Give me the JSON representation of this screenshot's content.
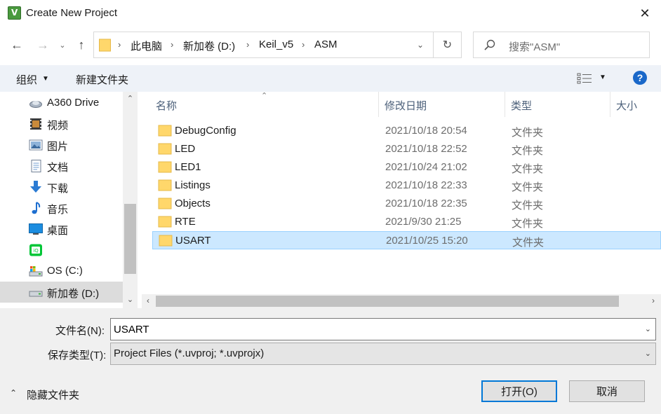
{
  "window": {
    "title": "Create New Project",
    "close_glyph": "✕",
    "app_icon": "keil-uvision-icon"
  },
  "nav": {
    "back_glyph": "←",
    "forward_glyph": "→",
    "recent_glyph": "⌄",
    "up_glyph": "↑"
  },
  "address": {
    "crumbs": [
      "此电脑",
      "新加卷 (D:)",
      "Keil_v5",
      "ASM"
    ],
    "separator": "›",
    "dropdown_glyph": "⌄",
    "refresh_glyph": "↻"
  },
  "search": {
    "placeholder": "搜索\"ASM\""
  },
  "toolbar": {
    "organize_label": "组织",
    "organize_caret": "▼",
    "new_folder_label": "新建文件夹",
    "view_caret": "▼",
    "help_label": "?"
  },
  "navpane": {
    "items": [
      {
        "label": "A360 Drive",
        "icon": "cloud-drive-icon"
      },
      {
        "label": "视频",
        "icon": "video-icon"
      },
      {
        "label": "图片",
        "icon": "pictures-icon"
      },
      {
        "label": "文档",
        "icon": "documents-icon"
      },
      {
        "label": "下载",
        "icon": "download-icon"
      },
      {
        "label": "音乐",
        "icon": "music-icon"
      },
      {
        "label": "桌面",
        "icon": "desktop-icon"
      },
      {
        "label": "",
        "icon": "iqiyi-icon"
      },
      {
        "label": "OS (C:)",
        "icon": "drive-c-icon"
      },
      {
        "label": "新加卷 (D:)",
        "icon": "drive-d-icon"
      }
    ],
    "selected_index": 9,
    "scroll_up_glyph": "⌃",
    "scroll_down_glyph": "⌄"
  },
  "filelist": {
    "columns": [
      "名称",
      "修改日期",
      "类型",
      "大小"
    ],
    "sort_glyph": "⌃",
    "rows": [
      {
        "name": "DebugConfig",
        "date": "2021/10/18 20:54",
        "type": "文件夹"
      },
      {
        "name": "LED",
        "date": "2021/10/18 22:52",
        "type": "文件夹"
      },
      {
        "name": "LED1",
        "date": "2021/10/24 21:02",
        "type": "文件夹"
      },
      {
        "name": "Listings",
        "date": "2021/10/18 22:33",
        "type": "文件夹"
      },
      {
        "name": "Objects",
        "date": "2021/10/18 22:35",
        "type": "文件夹"
      },
      {
        "name": "RTE",
        "date": "2021/9/30 21:25",
        "type": "文件夹"
      },
      {
        "name": "USART",
        "date": "2021/10/25 15:20",
        "type": "文件夹"
      }
    ],
    "selected_index": 6,
    "hscroll_left_glyph": "‹",
    "hscroll_right_glyph": "›"
  },
  "form": {
    "filename_label": "文件名(N):",
    "filename_value": "USART",
    "filetype_label": "保存类型(T):",
    "filetype_value": "Project Files (*.uvproj; *.uvprojx)",
    "caret_glyph": "⌄"
  },
  "footer": {
    "hide_folders_label": "隐藏文件夹",
    "hide_caret": "⌃",
    "open_label": "打开(O)",
    "cancel_label": "取消"
  },
  "colors": {
    "toolbar_bg": "#eef2f8",
    "selection_bg": "#cce8ff",
    "selection_border": "#99d1ff",
    "accent": "#0078d7",
    "folder": "#ffd76b"
  }
}
